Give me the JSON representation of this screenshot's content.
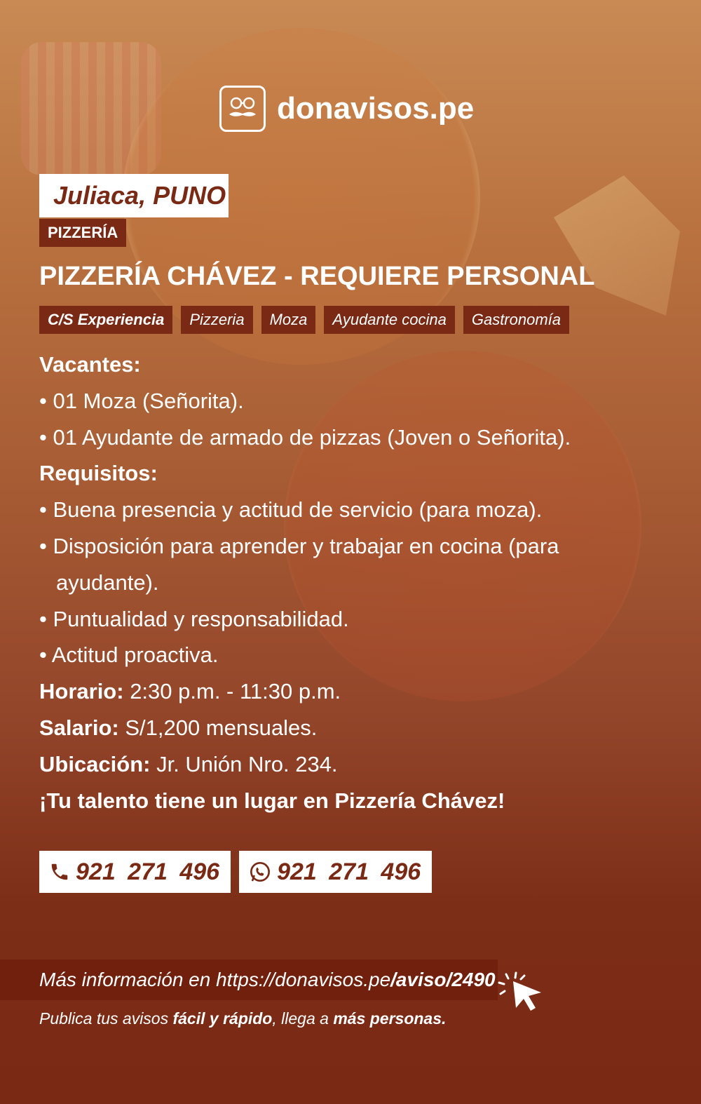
{
  "brand": {
    "name": "donavisos.pe"
  },
  "location": "Juliaca, PUNO",
  "category": "PIZZERÍA",
  "title": "PIZZERÍA CHÁVEZ - REQUIERE PERSONAL",
  "tags": [
    "C/S Experiencia",
    "Pizzeria",
    "Moza",
    "Ayudante cocina",
    "Gastronomía"
  ],
  "content": {
    "vacantes_heading": "Vacantes:",
    "vacantes": [
      "• 01 Moza (Señorita).",
      "• 01 Ayudante de armado de pizzas (Joven o Señorita)."
    ],
    "requisitos_heading": "Requisitos:",
    "requisitos": [
      "• Buena presencia y actitud de servicio (para moza).",
      "• Disposición para aprender y trabajar en cocina (para",
      "ayudante).",
      "• Puntualidad y responsabilidad.",
      "• Actitud proactiva."
    ],
    "horario_label": "Horario:",
    "horario_value": " 2:30 p.m. - 11:30 p.m.",
    "salario_label": "Salario:",
    "salario_value": " S/1,200 mensuales.",
    "ubicacion_label": "Ubicación:",
    "ubicacion_value": " Jr. Unión Nro. 234.",
    "closing": "¡Tu talento tiene un lugar en Pizzería Chávez!"
  },
  "contact": {
    "phone": "921 271 496",
    "whatsapp": "921 271 496",
    "phone_icon": "phone-icon",
    "whatsapp_icon": "whatsapp-icon"
  },
  "more_info": {
    "prefix": "Más información en https://donavisos.pe",
    "path": "/aviso/2490"
  },
  "footer": {
    "part1": "Publica tus avisos ",
    "part2": "fácil y rápido",
    "part3": ", llega a ",
    "part4": "más personas."
  },
  "colors": {
    "accent": "#7a2914",
    "text": "#ffffff"
  }
}
